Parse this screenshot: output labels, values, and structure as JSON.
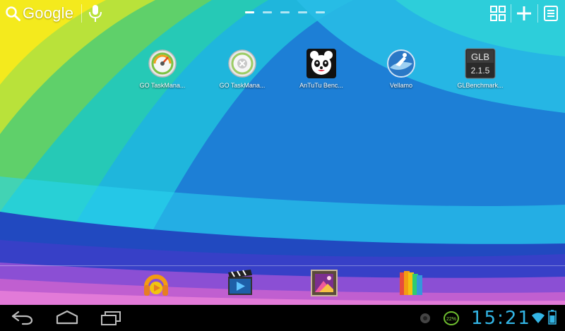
{
  "search": {
    "label": "Google"
  },
  "page_indicator": {
    "pages": 5,
    "active": 0
  },
  "apps": [
    {
      "label": "GO TaskMana..."
    },
    {
      "label": "GO TaskMana..."
    },
    {
      "label": "AnTuTu Benc..."
    },
    {
      "label": "Vellamo"
    },
    {
      "label": "GLBenchmark..."
    }
  ],
  "glb_badge": {
    "line1": "GLB",
    "line2": "2.1.5"
  },
  "dock": [
    {
      "icon": "play-music-icon"
    },
    {
      "icon": "video-player-icon"
    },
    {
      "icon": "gallery-icon"
    },
    {
      "icon": "books-icon"
    }
  ],
  "status": {
    "time": "15:21",
    "battery_saver_percent": "22%"
  },
  "colors": {
    "accent": "#33b5e5",
    "system_bar": "#000000"
  }
}
